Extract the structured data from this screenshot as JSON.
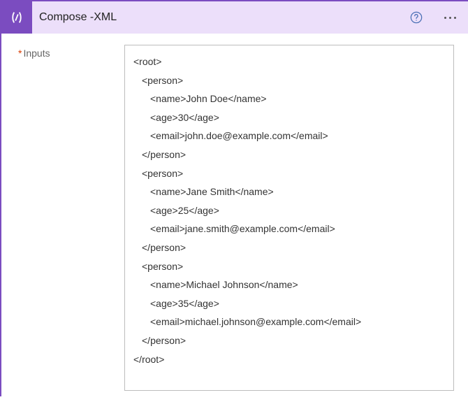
{
  "header": {
    "title": "Compose -XML"
  },
  "form": {
    "inputs_label": "Inputs",
    "lines": [
      {
        "cls": "",
        "text": "<root>"
      },
      {
        "cls": "ind1",
        "text": "<person>"
      },
      {
        "cls": "ind2",
        "text": "<name>John Doe</name>"
      },
      {
        "cls": "ind2",
        "text": "<age>30</age>"
      },
      {
        "cls": "ind2",
        "text": "<email>john.doe@example.com</email>"
      },
      {
        "cls": "ind1",
        "text": "</person>"
      },
      {
        "cls": "ind1",
        "text": "<person>"
      },
      {
        "cls": "ind2",
        "text": "<name>Jane Smith</name>"
      },
      {
        "cls": "ind2",
        "text": "<age>25</age>"
      },
      {
        "cls": "ind2",
        "text": "<email>jane.smith@example.com</email>"
      },
      {
        "cls": "ind1",
        "text": "</person>"
      },
      {
        "cls": "ind1",
        "text": "<person>"
      },
      {
        "cls": "ind2",
        "text": "<name>Michael Johnson</name>"
      },
      {
        "cls": "ind2",
        "text": "<age>35</age>"
      },
      {
        "cls": "ind2",
        "text": "<email>michael.johnson@example.com</email>"
      },
      {
        "cls": "ind1",
        "text": "</person>"
      },
      {
        "cls": "",
        "text": "</root>"
      }
    ]
  }
}
